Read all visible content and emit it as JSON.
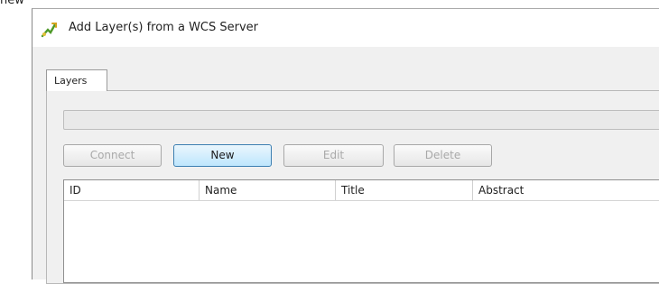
{
  "fragment_text": "new",
  "window": {
    "title": "Add Layer(s) from a WCS Server",
    "icon": "qgis-wcs-layer-icon"
  },
  "tabs": [
    {
      "label": "Layers",
      "selected": true
    }
  ],
  "connection_select": {
    "value": ""
  },
  "buttons": {
    "connect": "Connect",
    "new": "New",
    "edit": "Edit",
    "delete": "Delete"
  },
  "table": {
    "columns": [
      "ID",
      "Name",
      "Title",
      "Abstract"
    ],
    "rows": []
  },
  "colors": {
    "primary_button": "#bee6fd",
    "primary_border": "#3c7fb1",
    "disabled_text": "#a9a9a9"
  }
}
